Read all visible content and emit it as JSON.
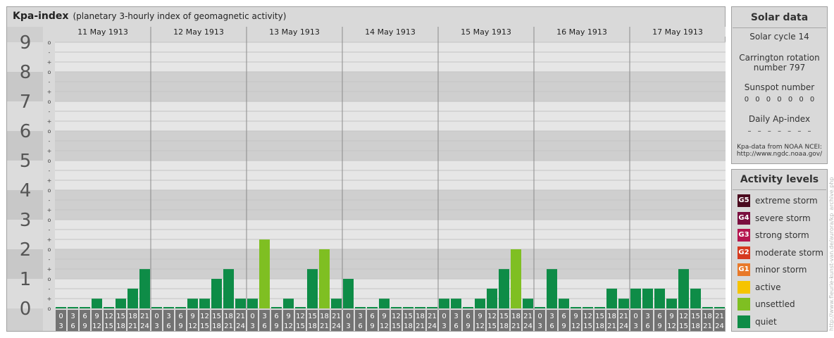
{
  "title": "Kpa-index",
  "subtitle": "(planetary 3-hourly index of geomagnetic activity)",
  "chart_data": {
    "type": "bar",
    "title": "Kpa-index",
    "subtitle": "(planetary 3-hourly index of geomagnetic activity)",
    "ylim": [
      0,
      9
    ],
    "y_ticks": [
      "0",
      "1",
      "2",
      "3",
      "4",
      "5",
      "6",
      "7",
      "8",
      "9"
    ],
    "y_minor_ticks": [
      "o",
      "+",
      "-"
    ],
    "days": [
      "11 May 1913",
      "12 May 1913",
      "13 May 1913",
      "14 May 1913",
      "15 May 1913",
      "16 May 1913",
      "17 May 1913"
    ],
    "hour_start": [
      "0",
      "3",
      "6",
      "9",
      "12",
      "15",
      "18",
      "21"
    ],
    "hour_end": [
      "3",
      "6",
      "9",
      "12",
      "15",
      "18",
      "21",
      "24"
    ],
    "values": [
      [
        0,
        0,
        0,
        0.33,
        0,
        0.33,
        0.67,
        1.33
      ],
      [
        0,
        0,
        0,
        0.33,
        0.33,
        1,
        1.33,
        0.33
      ],
      [
        0.33,
        2.33,
        0,
        0.33,
        0,
        1.33,
        2,
        0.33
      ],
      [
        1,
        0,
        0,
        0.33,
        0,
        0,
        0,
        0
      ],
      [
        0.33,
        0.33,
        0,
        0.33,
        0.67,
        1.33,
        2,
        0.33
      ],
      [
        0,
        1.33,
        0.33,
        0,
        0,
        0,
        0.67,
        0.33
      ],
      [
        0.67,
        0.67,
        0.67,
        0.33,
        1.33,
        0.67,
        0,
        0
      ]
    ],
    "colors": {
      "quiet": "#0e8c47",
      "unsettled": "#7fbf22"
    },
    "grid": true
  },
  "solar": {
    "title": "Solar data",
    "cycle": "Solar cycle 14",
    "carrington_line1": "Carrington rotation",
    "carrington_line2": "number 797",
    "sunspot_label": "Sunspot number",
    "sunspot_values": "0 0 0 0 0 0 0",
    "ap_label": "Daily Ap-index",
    "ap_values": "– – – – – – –",
    "source_line1": "Kpa-data from NOAA NCEI:",
    "source_line2": "http://www.ngdc.noaa.gov/"
  },
  "levels": {
    "title": "Activity levels",
    "items": [
      {
        "code": "G5",
        "label": "extreme storm",
        "color": "#4a0a1e"
      },
      {
        "code": "G4",
        "label": "severe storm",
        "color": "#7a0e3f"
      },
      {
        "code": "G3",
        "label": "strong storm",
        "color": "#b5144f"
      },
      {
        "code": "G2",
        "label": "moderate storm",
        "color": "#d63a1f"
      },
      {
        "code": "G1",
        "label": "minor storm",
        "color": "#e8792a"
      },
      {
        "code": "",
        "label": "active",
        "color": "#f6c400"
      },
      {
        "code": "",
        "label": "unsettled",
        "color": "#7fbf22"
      },
      {
        "code": "",
        "label": "quiet",
        "color": "#0e8c47"
      }
    ]
  },
  "watermark": "http://www.fleurie-kunst-van.de/aurora/kp_archive.php"
}
